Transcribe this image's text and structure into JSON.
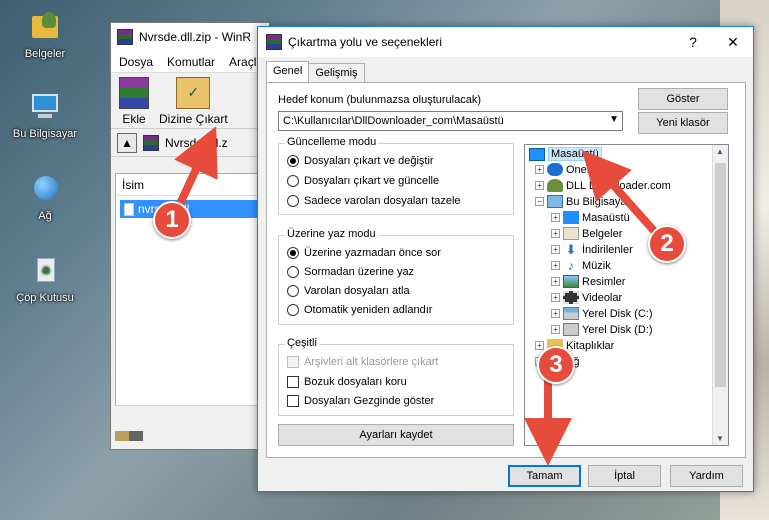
{
  "desktop": {
    "icons": [
      {
        "label": "Belgeler"
      },
      {
        "label": "Bu Bilgisayar"
      },
      {
        "label": "Ağ"
      },
      {
        "label": "Çöp Kutusu"
      }
    ]
  },
  "winrar": {
    "title": "Nvrsde.dll.zip - WinR",
    "menu": [
      "Dosya",
      "Komutlar",
      "Araçla"
    ],
    "tools": {
      "add": "Ekle",
      "extract": "Dizine Çıkart"
    },
    "address": "Nvrsde.dll.z",
    "list_header": "İsim",
    "file": "nvrsde.dll"
  },
  "dialog": {
    "title": "Çıkartma yolu ve seçenekleri",
    "help": "?",
    "close": "✕",
    "tabs": [
      "Genel",
      "Gelişmiş"
    ],
    "dest_label": "Hedef konum (bulunmazsa oluşturulacak)",
    "dest_value": "C:\\Kullanıcılar\\DllDownloader_com\\Masaüstü",
    "show_btn": "Göster",
    "new_folder_btn": "Yeni klasör",
    "update": {
      "title": "Güncelleme modu",
      "options": [
        "Dosyaları çıkart ve değiştir",
        "Dosyaları çıkart ve güncelle",
        "Sadece varolan dosyaları tazele"
      ],
      "selected": 0
    },
    "overwrite": {
      "title": "Üzerine yaz modu",
      "options": [
        "Üzerine yazmadan önce sor",
        "Sormadan üzerine yaz",
        "Varolan dosyaları atla",
        "Otomatik yeniden adlandır"
      ],
      "selected": 0
    },
    "misc": {
      "title": "Çeşitli",
      "options": [
        "Arşivleri alt klasörlere çıkart",
        "Bozuk dosyaları koru",
        "Dosyaları Gezginde göster"
      ]
    },
    "save_btn": "Ayarları kaydet",
    "tree": {
      "desktop": "Masaüstü",
      "onedrive": "OneDrive",
      "user": "DLL Downloader.com",
      "thispc": "Bu Bilgisayar",
      "children": [
        "Masaüstü",
        "Belgeler",
        "İndirilenler",
        "Müzik",
        "Resimler",
        "Videolar",
        "Yerel Disk (C:)",
        "Yerel Disk (D:)"
      ],
      "libraries": "Kitaplıklar",
      "network": "Ağ"
    },
    "ok": "Tamam",
    "cancel": "İptal",
    "help_btn": "Yardım"
  },
  "callouts": [
    "1",
    "2",
    "3"
  ],
  "colors": {
    "callout": "#e64b3b",
    "selection": "#3390ff",
    "accent": "#0078d7"
  }
}
